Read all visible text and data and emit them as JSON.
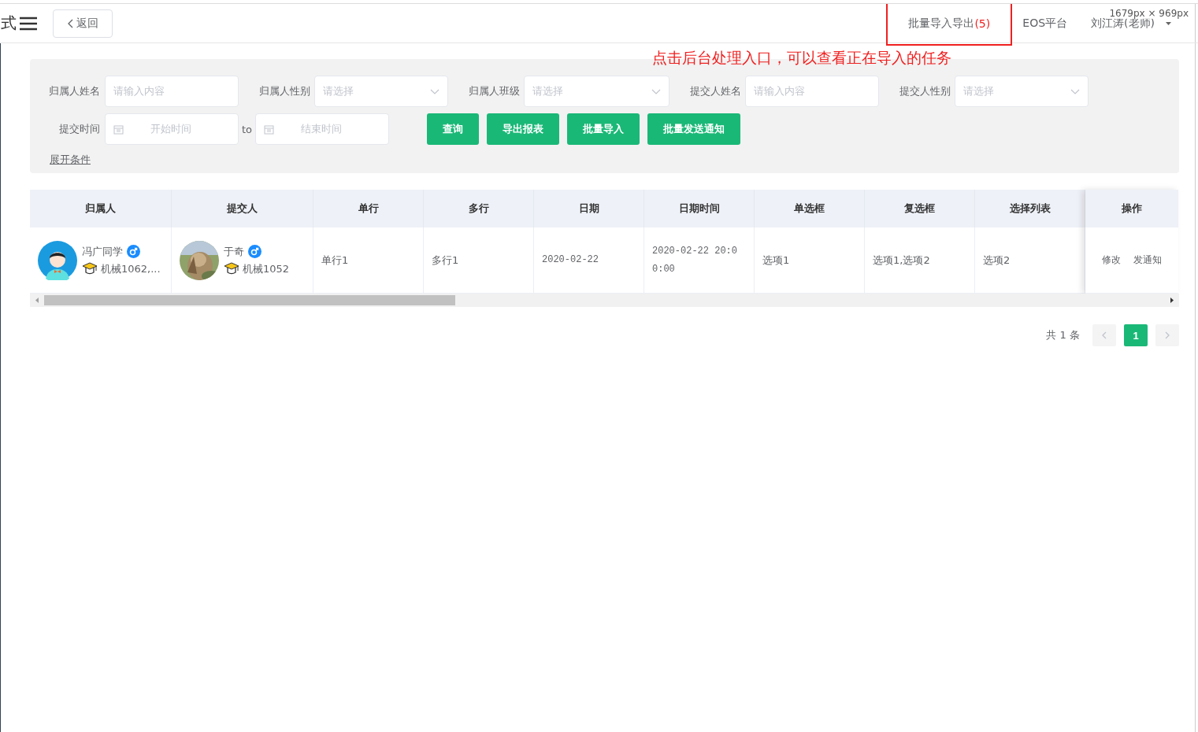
{
  "header": {
    "title_fragment": "式",
    "back_button": "返回",
    "nav": [
      {
        "label": "批量导入导出",
        "count": "(5)",
        "highlighted": true
      },
      {
        "label": "EOS平台",
        "highlighted": false
      }
    ],
    "user": "刘江涛(老师)",
    "size_hint": "1679px × 969px"
  },
  "annotation": "点击后台处理入口，可以查看正在导入的任务",
  "filters": [
    {
      "kind": "text",
      "label": "归属人姓名",
      "placeholder": "请输入内容"
    },
    {
      "kind": "select",
      "label": "归属人性别",
      "placeholder": "请选择"
    },
    {
      "kind": "select",
      "label": "归属人班级",
      "placeholder": "请选择"
    },
    {
      "kind": "text",
      "label": "提交人姓名",
      "placeholder": "请输入内容"
    },
    {
      "kind": "select",
      "label": "提交人性别",
      "placeholder": "请选择"
    },
    {
      "kind": "daterange",
      "label": "提交时间",
      "start_placeholder": "开始时间",
      "separator": "to",
      "end_placeholder": "结束时间"
    }
  ],
  "buttons": [
    "查询",
    "导出报表",
    "批量导入",
    "批量发送通知"
  ],
  "expand_link": "展开条件",
  "table": {
    "columns": [
      "归属人",
      "提交人",
      "单行",
      "多行",
      "日期",
      "日期时间",
      "单选框",
      "复选框",
      "选择列表"
    ],
    "action_column": "操作",
    "rows": [
      {
        "cells": [
          {
            "kind": "cartoon",
            "name": "冯广同学",
            "class": "机械1062,..."
          },
          {
            "kind": "picture",
            "name": "于奇",
            "class": "机械1052"
          },
          {
            "kind": "text",
            "text": "单行1"
          },
          {
            "kind": "text",
            "text": "多行1"
          },
          {
            "kind": "text",
            "text": "2020-02-22"
          },
          {
            "kind": "text",
            "text": "2020-02-22 20:00:00"
          },
          {
            "kind": "text",
            "text": "选项1"
          },
          {
            "kind": "text",
            "text": "选项1,选项2"
          },
          {
            "kind": "text",
            "text": "选项2"
          }
        ],
        "actions": [
          "修改",
          "发通知"
        ]
      }
    ]
  },
  "pagination": {
    "total": "共 1 条",
    "pages": [
      {
        "label": "1",
        "selected": true
      }
    ]
  }
}
